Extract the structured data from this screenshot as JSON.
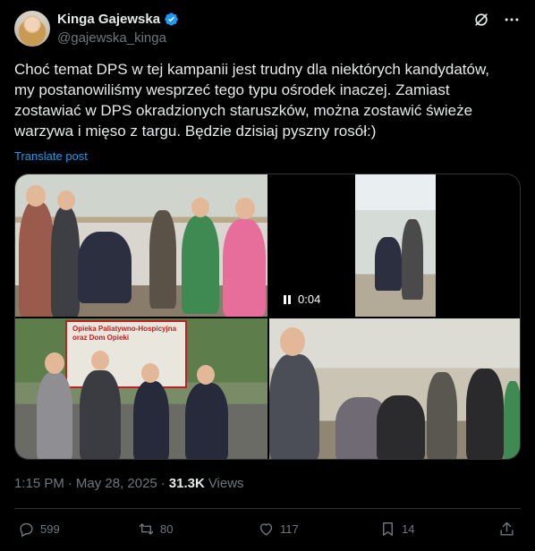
{
  "author": {
    "display_name": "Kinga Gajewska",
    "handle": "@gajewska_kinga",
    "verified": true
  },
  "header_icons": [
    "grok-icon",
    "more-icon"
  ],
  "tweet": {
    "text": "Choć temat DPS w tej kampanii jest trudny dla niektórych kandydatów,\nmy postanowiliśmy wesprzeć tego typu ośrodek inaczej. Zamiast\nzostawiać w DPS okradzionych staruszków, można zostawić świeże\nwarzywa i mięso z targu. Będzie dzisiaj pyszny rosół:)",
    "translate_label": "Translate post"
  },
  "media": {
    "video_duration": "0:04",
    "banner_text": "Opieka Paliatywno-Hospicyjna oraz Dom Opieki"
  },
  "meta": {
    "time": "1:15 PM",
    "separator": "·",
    "date": "May 28, 2025",
    "views_count": "31.3K",
    "views_label": "Views"
  },
  "actions": {
    "reply_count": "599",
    "retweet_count": "80",
    "like_count": "117",
    "bookmark_count": "14"
  },
  "colors": {
    "background": "#000000",
    "text": "#e7e9ea",
    "secondary": "#71767b",
    "accent": "#1d9bf0",
    "border": "#2f3336"
  }
}
